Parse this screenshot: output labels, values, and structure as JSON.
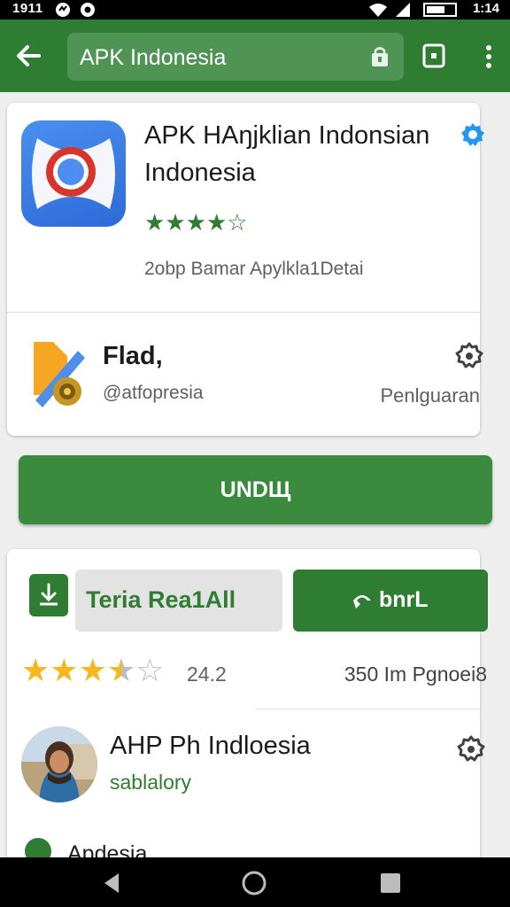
{
  "status_bar": {
    "time": "1911",
    "right_time": "1:14"
  },
  "app_bar": {
    "search_query": "APK Indonesia"
  },
  "app_card": {
    "title": "APK HAŋjklian Indonsian Indonesia",
    "rating_stars": 3.5,
    "meta": "2obp Bamar Apylkla1Detai",
    "developer_name": "Flad,",
    "developer_handle": "@atfopresia",
    "developer_action": "Penlguaran"
  },
  "primary_button": {
    "label": "UNDЩ"
  },
  "detail_card": {
    "secondary_label": "Teria Rea1All",
    "action_button_label": "bnrL",
    "rating_stars": 3.5,
    "rating_value": "24.2",
    "installs": "350 Im Pgnoei8",
    "review_title": "AHP Ph Indloesia",
    "review_subtitle": "sablalory",
    "peek_text": "Apdesia"
  },
  "colors": {
    "brand_green": "#2f7d32",
    "accent_blue": "#2196f3",
    "star_yellow": "#f6b81c"
  },
  "icons": [
    "back-arrow-icon",
    "lock-icon",
    "tabs-icon",
    "more-vert-icon",
    "verified-badge-icon",
    "settings-gear-icon",
    "download-icon",
    "link-icon",
    "nav-back-icon",
    "nav-home-icon",
    "nav-recents-icon"
  ]
}
